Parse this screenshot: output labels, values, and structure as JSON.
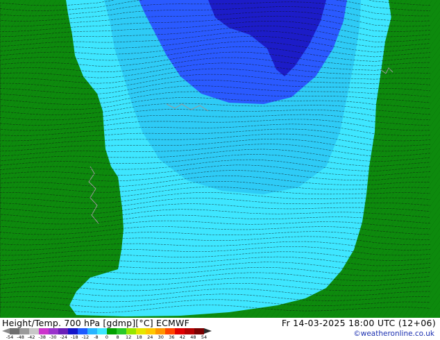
{
  "title": {
    "left": "Height/Temp. 700 hPa [gdmp][°C] ECMWF",
    "right": "Fr 14-03-2025 18:00 UTC (12+06)"
  },
  "credit": "©weatheronline.co.uk",
  "legend": {
    "ticks": [
      "-54",
      "-48",
      "-42",
      "-38",
      "-30",
      "-24",
      "-18",
      "-12",
      "-8",
      "0",
      "8",
      "12",
      "18",
      "24",
      "30",
      "36",
      "42",
      "48",
      "54"
    ],
    "colors": [
      "#6e6e6e",
      "#9a9a9a",
      "#c8c8c8",
      "#cc33cc",
      "#9933cc",
      "#6a1fb8",
      "#1414c8",
      "#1e5aff",
      "#28b4ff",
      "#3ce6ff",
      "#00a000",
      "#28c828",
      "#96e600",
      "#e6e600",
      "#ffc800",
      "#ff9600",
      "#ff4600",
      "#e00000",
      "#b40000",
      "#780000"
    ]
  },
  "colors": {
    "land_green": "#0d8a0d",
    "land_green_light": "#15a015",
    "field_cyan": "#3ee6ff",
    "field_cyan_dark": "#20b4ee",
    "field_blue": "#2a5aff",
    "field_blue_dark": "#1c1cc8",
    "contour": "#111111"
  }
}
